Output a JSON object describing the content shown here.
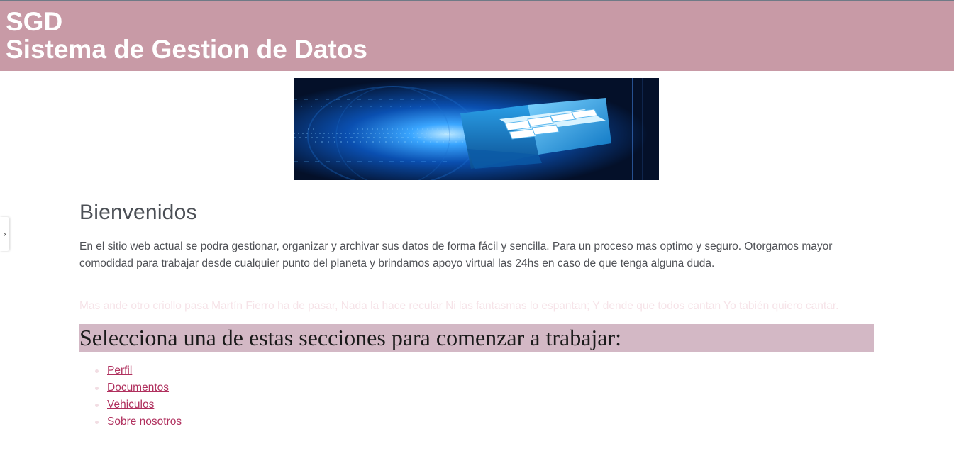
{
  "header": {
    "line1": "SGD",
    "line2": "Sistema de Gestion de Datos",
    "background": "#c89aa6",
    "text_color": "#ffffff"
  },
  "banner": {
    "description_icon": "database-file-drawer-image"
  },
  "side_handle": {
    "icon": "chevron-right-icon",
    "glyph": "›"
  },
  "main": {
    "title": "Bienvenidos",
    "intro": "En el sitio web actual se podra gestionar, organizar y archivar sus datos de forma fácil y sencilla. Para un proceso mas optimo y seguro. Otorgamos mayor comodidad para trabajar desde cualquier punto del planeta y brindamos apoyo virtual las 24hs en caso de que tenga alguna duda.",
    "faint_text": "Mas ande otro criollo pasa Martín Fierro ha de pasar, Nada la hace recular Ni las fantasmas lo espantan; Y dende que todos cantan Yo tabién quiero cantar.",
    "section_title": "Selecciona una de estas secciones para comenzar a trabajar:",
    "section_background": "#d3b8c5",
    "links": [
      {
        "label": "Perfil"
      },
      {
        "label": "Documentos"
      },
      {
        "label": "Vehiculos"
      },
      {
        "label": "Sobre nosotros"
      }
    ],
    "link_color": "#b0305e"
  }
}
